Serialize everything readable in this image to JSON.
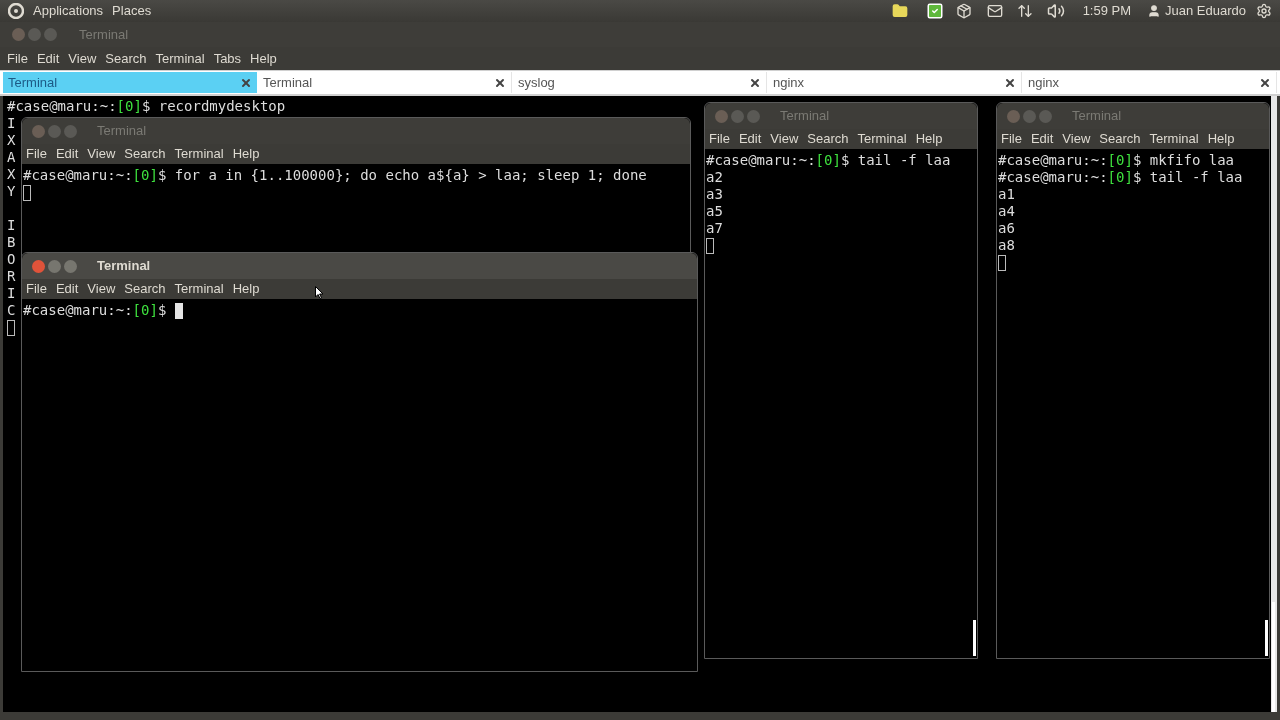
{
  "top_panel": {
    "menus": [
      "Applications",
      "Places"
    ],
    "clock": "1:59 PM",
    "user": "Juan Eduardo"
  },
  "window": {
    "title": "Terminal",
    "active": false,
    "menu": [
      "File",
      "Edit",
      "View",
      "Search",
      "Terminal",
      "Tabs",
      "Help"
    ],
    "tabs": [
      {
        "label": "Terminal",
        "selected": true
      },
      {
        "label": "Terminal",
        "selected": false
      },
      {
        "label": "syslog",
        "selected": false
      },
      {
        "label": "nginx",
        "selected": false
      },
      {
        "label": "nginx",
        "selected": false
      }
    ]
  },
  "terminal": {
    "lines": [
      {
        "kind": "prompt",
        "host": "#case@maru:~:",
        "status": "[0]",
        "command": "$ recordmydesktop"
      },
      {
        "kind": "output",
        "text": "I"
      },
      {
        "kind": "output",
        "text": "X"
      },
      {
        "kind": "output",
        "text": "A"
      },
      {
        "kind": "output",
        "text": "X"
      },
      {
        "kind": "output",
        "text": "Y"
      },
      {
        "kind": "blank"
      },
      {
        "kind": "output",
        "text": "I"
      },
      {
        "kind": "output",
        "text": "B"
      },
      {
        "kind": "output",
        "text": "O"
      },
      {
        "kind": "output",
        "text": "R"
      },
      {
        "kind": "output",
        "text": "I"
      },
      {
        "kind": "output",
        "text": "C"
      },
      {
        "kind": "cursor",
        "filled": false
      }
    ]
  },
  "windows": [
    {
      "title": "Terminal",
      "active": false,
      "menu": [
        "File",
        "Edit",
        "View",
        "Search",
        "Terminal",
        "Help"
      ],
      "lines": [
        {
          "kind": "prompt",
          "host": "#case@maru:~:",
          "status": "[0]",
          "command": "$ for a in {1..100000}; do echo a${a} > laa; sleep 1; done"
        },
        {
          "kind": "cursor",
          "filled": false
        }
      ]
    },
    {
      "title": "Terminal",
      "active": true,
      "menu": [
        "File",
        "Edit",
        "View",
        "Search",
        "Terminal",
        "Help"
      ],
      "lines": [
        {
          "kind": "prompt_cursor",
          "host": "#case@maru:~:",
          "status": "[0]",
          "command": "$ ",
          "filled": true
        }
      ]
    },
    {
      "title": "Terminal",
      "active": false,
      "menu": [
        "File",
        "Edit",
        "View",
        "Search",
        "Terminal",
        "Help"
      ],
      "lines": [
        {
          "kind": "prompt",
          "host": "#case@maru:~:",
          "status": "[0]",
          "command": "$ tail -f laa"
        },
        {
          "kind": "output",
          "text": "a2"
        },
        {
          "kind": "output",
          "text": "a3"
        },
        {
          "kind": "output",
          "text": "a5"
        },
        {
          "kind": "output",
          "text": "a7"
        },
        {
          "kind": "cursor",
          "filled": false
        }
      ]
    },
    {
      "title": "Terminal",
      "active": false,
      "menu": [
        "File",
        "Edit",
        "View",
        "Search",
        "Terminal",
        "Help"
      ],
      "lines": [
        {
          "kind": "prompt",
          "host": "#case@maru:~:",
          "status": "[0]",
          "command": "$ mkfifo laa"
        },
        {
          "kind": "prompt",
          "host": "#case@maru:~:",
          "status": "[0]",
          "command": "$ tail -f laa"
        },
        {
          "kind": "output",
          "text": "a1"
        },
        {
          "kind": "output",
          "text": "a4"
        },
        {
          "kind": "output",
          "text": "a6"
        },
        {
          "kind": "output",
          "text": "a8"
        },
        {
          "kind": "cursor",
          "filled": false
        }
      ]
    }
  ]
}
